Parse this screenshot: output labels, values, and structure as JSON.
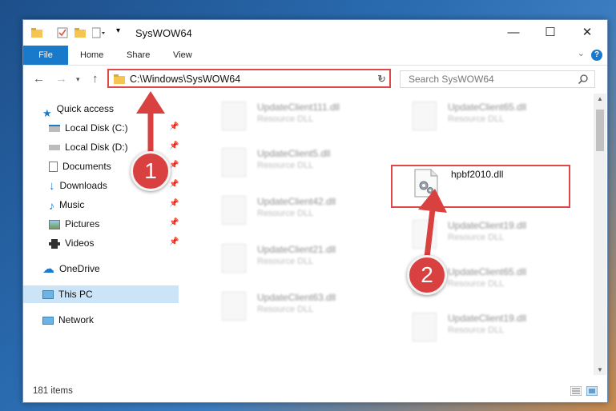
{
  "window": {
    "title": "SysWOW64",
    "minimize": "—",
    "maximize": "☐",
    "close": "✕"
  },
  "ribbon": {
    "file": "File",
    "tabs": [
      "Home",
      "Share",
      "View"
    ],
    "help": "?",
    "expand": "⌄"
  },
  "address": {
    "path": "C:\\Windows\\SysWOW64",
    "search_placeholder": "Search SysWOW64"
  },
  "nav": {
    "quick_access": "Quick access",
    "pinned": [
      "Local Disk (C:)",
      "Local Disk (D:)",
      "Documents",
      "Downloads",
      "Music",
      "Pictures",
      "Videos"
    ],
    "onedrive": "OneDrive",
    "this_pc": "This PC",
    "network": "Network"
  },
  "files": {
    "left": [
      {
        "name": "UpdateClient111.dll",
        "desc": "Resource DLL"
      },
      {
        "name": "UpdateClient5.dll",
        "desc": "Resource DLL"
      },
      {
        "name": "UpdateClient42.dll",
        "desc": "Resource DLL"
      },
      {
        "name": "UpdateClient21.dll",
        "desc": "Resource DLL"
      },
      {
        "name": "UpdateClient63.dll",
        "desc": "Resource DLL"
      }
    ],
    "right": [
      {
        "name": "UpdateClient65.dll",
        "desc": "Resource DLL"
      },
      {
        "name": "hpbf2010.dll",
        "desc": ""
      },
      {
        "name": "UpdateClient19.dll",
        "desc": "Resource DLL"
      },
      {
        "name": "UpdateClient65.dll",
        "desc": "Resource DLL"
      },
      {
        "name": "UpdateClient19.dll",
        "desc": "Resource DLL"
      }
    ]
  },
  "status": {
    "count": "181 items"
  },
  "annotations": {
    "marker1": "1",
    "marker2": "2",
    "color": "#d94040"
  }
}
